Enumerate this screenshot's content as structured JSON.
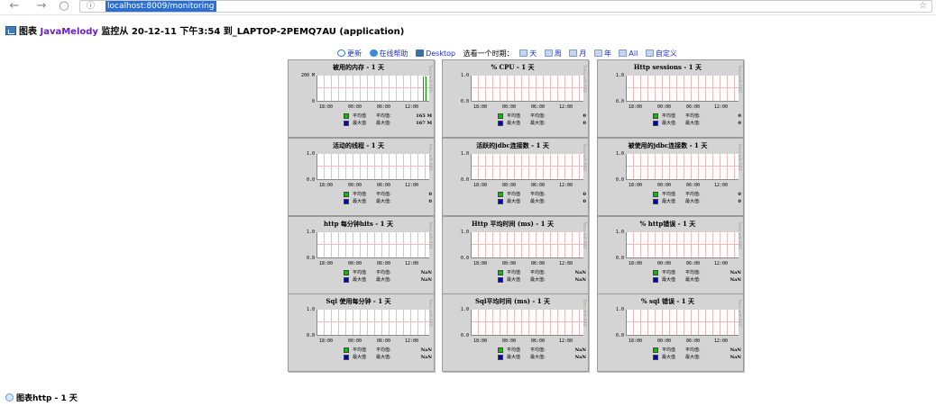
{
  "browser": {
    "back_icon": "←",
    "forward_icon": "→",
    "reload_icon": "○",
    "info_icon": "ⓘ",
    "url": "localhost:8009/monitoring",
    "star_icon": "☆"
  },
  "header": {
    "prefix": "图表 ",
    "app_link": "JavaMelody",
    "suffix": " 监控从 20-12-11 下午3:54 到_LAPTOP-2PEMQ7AU (application)"
  },
  "toolbar": {
    "refresh": "更新",
    "help": "在线帮助",
    "desktop": "Desktop",
    "period_label": "选看一个时期：",
    "periods": [
      "天",
      "周",
      "月",
      "年",
      "All",
      "自定义"
    ]
  },
  "charts": [
    {
      "title": "被用的内存 - 1 天",
      "ymax": "200 M",
      "ymin": "0",
      "avg": "165 M",
      "max": "167 M",
      "spike": true
    },
    {
      "title": "% CPU - 1 天",
      "ymax": "1.0",
      "ymin": "0.0",
      "avg": "0",
      "max": "0"
    },
    {
      "title": "Http sessions - 1 天",
      "ymax": "1.0",
      "ymin": "0.0",
      "avg": "0",
      "max": "0"
    },
    {
      "title": "活动的线程 - 1 天",
      "ymax": "1.0",
      "ymin": "0.0",
      "avg": "0",
      "max": "0"
    },
    {
      "title": "活跃的jdbc连接数 - 1 天",
      "ymax": "1.0",
      "ymin": "0.0",
      "avg": "0",
      "max": "0"
    },
    {
      "title": "被使用的jdbc连接数 - 1 天",
      "ymax": "1.0",
      "ymin": "0.0",
      "avg": "0",
      "max": "0"
    },
    {
      "title": "http 每分钟hits - 1 天",
      "ymax": "1.0",
      "ymin": "0.0",
      "avg": "NaN",
      "max": "NaN"
    },
    {
      "title": "Http 平均时间 (ms) - 1 天",
      "ymax": "1.0",
      "ymin": "0.0",
      "avg": "NaN",
      "max": "NaN"
    },
    {
      "title": "% http错误 - 1 天",
      "ymax": "1.0",
      "ymin": "0.0",
      "avg": "NaN",
      "max": "NaN"
    },
    {
      "title": "Sql 使用每分钟 - 1 天",
      "ymax": "1.0",
      "ymin": "0.0",
      "avg": "NaN",
      "max": "NaN"
    },
    {
      "title": "Sql平均时间 (ms) - 1 天",
      "ymax": "1.0",
      "ymin": "0.0",
      "avg": "NaN",
      "max": "NaN"
    },
    {
      "title": "% sql 错误 - 1 天",
      "ymax": "1.0",
      "ymin": "0.0",
      "avg": "NaN",
      "max": "NaN"
    }
  ],
  "chart_common": {
    "x_ticks": [
      "18:00",
      "00:00",
      "06:00",
      "12:00"
    ],
    "avg_name": "平均值",
    "avg_label": "平均值:",
    "max_name": "最大值",
    "max_label": "最大值:",
    "side_text": "Trend with RRD"
  },
  "footer": {
    "text": "图表http - 1 天"
  }
}
